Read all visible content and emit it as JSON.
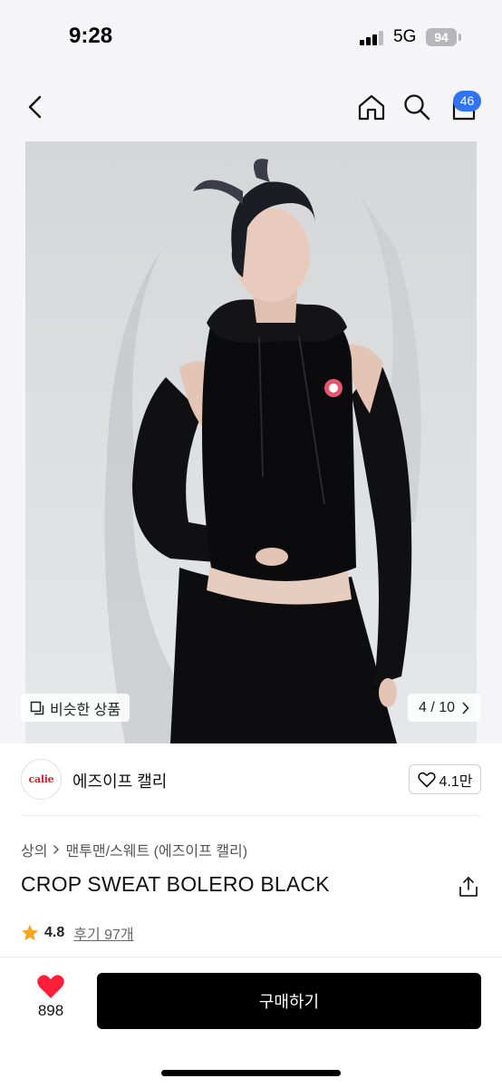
{
  "status_bar": {
    "time": "9:28",
    "network": "5G",
    "battery": "94"
  },
  "nav": {
    "back_icon": "chevron-left-icon",
    "home_icon": "home-icon",
    "search_icon": "search-icon",
    "cart_icon": "cart-icon",
    "cart_badge": "46",
    "badge_color": "#3173f1"
  },
  "gallery": {
    "similar_label": "비슷한 상품",
    "page_indicator": "4 / 10"
  },
  "brand": {
    "logo_text": "calie",
    "name": "에즈이프 캘리",
    "like_count": "4.1만"
  },
  "product": {
    "breadcrumb": {
      "category": "상의",
      "subcategory": "맨투맨/스웨트 (에즈이프 캘리)"
    },
    "title": "CROP SWEAT BOLERO BLACK",
    "rating": "4.8",
    "reviews_label": "후기 97개"
  },
  "bottom_bar": {
    "wish_count": "898",
    "buy_label": "구매하기",
    "heart_color": "#ff1f38"
  }
}
